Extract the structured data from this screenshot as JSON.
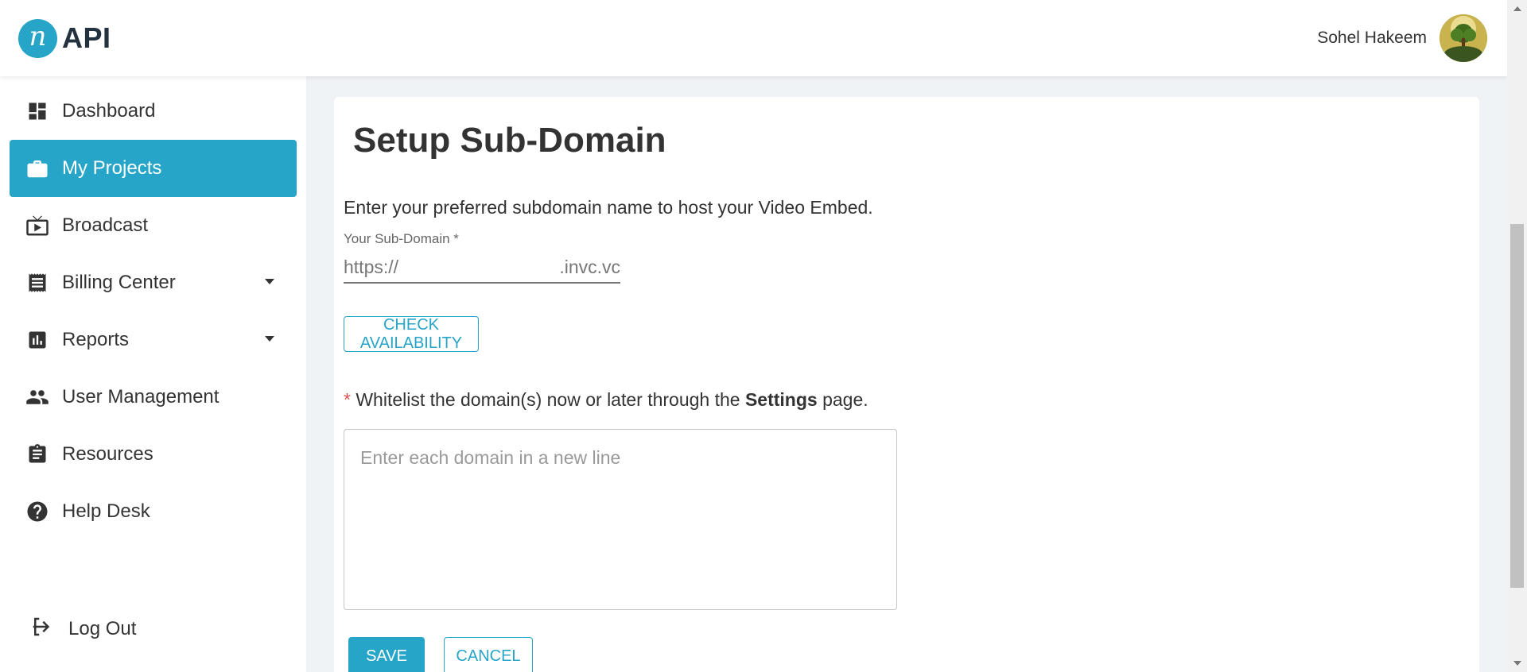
{
  "header": {
    "logo_text": "API",
    "logo_mark_letter": "n",
    "user_name": "Sohel Hakeem"
  },
  "sidebar": {
    "items": [
      {
        "label": "Dashboard",
        "icon": "dashboard-icon"
      },
      {
        "label": "My Projects",
        "icon": "briefcase-icon",
        "active": true
      },
      {
        "label": "Broadcast",
        "icon": "tv-icon"
      },
      {
        "label": "Billing Center",
        "icon": "receipt-icon",
        "has_dropdown": true
      },
      {
        "label": "Reports",
        "icon": "bar-chart-icon",
        "has_dropdown": true
      },
      {
        "label": "User Management",
        "icon": "people-icon"
      },
      {
        "label": "Resources",
        "icon": "clipboard-icon"
      },
      {
        "label": "Help Desk",
        "icon": "help-circle-icon"
      }
    ],
    "logout_label": "Log Out"
  },
  "main": {
    "title": "Setup Sub-Domain",
    "intro": "Enter your preferred subdomain name to host your Video Embed.",
    "subdomain": {
      "label": "Your Sub-Domain *",
      "prefix": "https://",
      "value": "",
      "suffix": ".invc.vc"
    },
    "check_button": "CHECK AVAILABILITY",
    "whitelist": {
      "star": "*",
      "text_before": " Whitelist the domain(s) now or later through the ",
      "link_text": "Settings",
      "text_after": " page."
    },
    "domains_placeholder": "Enter each domain in a new line",
    "save_button": "SAVE",
    "cancel_button": "CANCEL"
  },
  "colors": {
    "accent": "#26a5c8",
    "text": "#333333",
    "background": "#f0f3f6",
    "required": "#d9534f"
  }
}
